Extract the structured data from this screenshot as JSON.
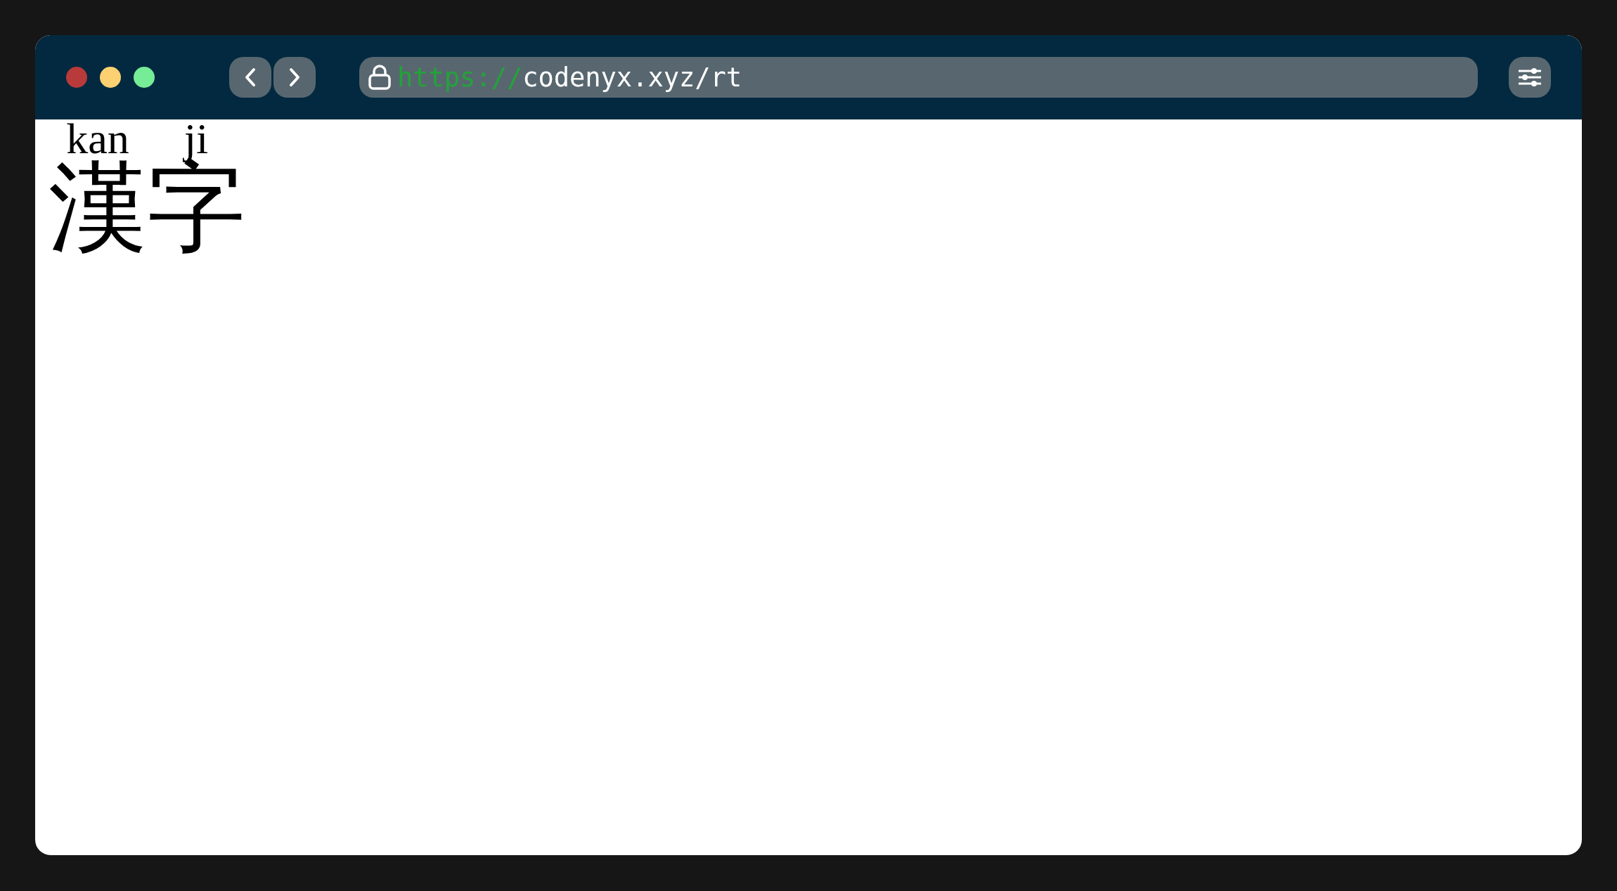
{
  "browser": {
    "url": {
      "scheme": "https://",
      "address": "codenyx.xyz/rt"
    }
  },
  "page": {
    "ruby": [
      {
        "base": "漢",
        "reading": "kan"
      },
      {
        "base": "字",
        "reading": "ji"
      }
    ]
  }
}
